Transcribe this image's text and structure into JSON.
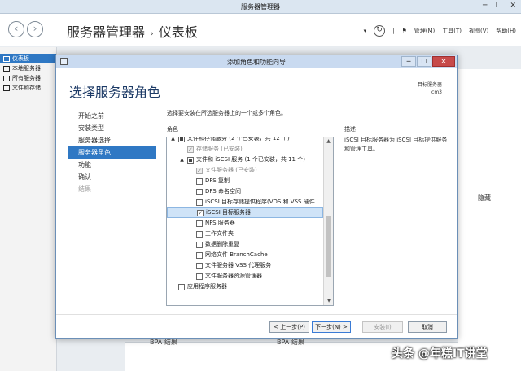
{
  "window": {
    "title": "服务器管理器",
    "controls": [
      "─",
      "☐",
      "✕"
    ]
  },
  "header": {
    "breadcrumb_root": "服务器管理器",
    "breadcrumb_sep": "›",
    "breadcrumb_page": "仪表板",
    "menu": [
      "管理(M)",
      "工具(T)",
      "视图(V)",
      "帮助(H)"
    ]
  },
  "sidebar": {
    "items": [
      {
        "label": "仪表板",
        "icon": "dashboard-icon"
      },
      {
        "label": "本地服务器",
        "icon": "server-icon"
      },
      {
        "label": "所有服务器",
        "icon": "servers-icon"
      },
      {
        "label": "文件和存储",
        "icon": "storage-icon"
      }
    ]
  },
  "background": {
    "hide_label": "隐藏",
    "bpa_1": "BPA 结果",
    "bpa_2": "BPA 结果"
  },
  "watermark": "头条 @年糕IT讲堂",
  "dialog": {
    "title": "添加角色和功能向导",
    "heading": "选择服务器角色",
    "target_label": "目标服务器",
    "target_value": "cm3",
    "steps": [
      {
        "label": "开始之前",
        "state": "normal"
      },
      {
        "label": "安装类型",
        "state": "normal"
      },
      {
        "label": "服务器选择",
        "state": "normal"
      },
      {
        "label": "服务器角色",
        "state": "active"
      },
      {
        "label": "功能",
        "state": "normal"
      },
      {
        "label": "确认",
        "state": "normal"
      },
      {
        "label": "结果",
        "state": "disabled"
      }
    ],
    "instruction": "选择要安装在所选服务器上的一个或多个角色。",
    "roles_header": "角色",
    "desc_header": "描述",
    "description": "iSCSI 目标服务器为 iSCSI 目标提供服务和管理工具。",
    "roles": [
      {
        "label": "文件和存储服务 (2 个已安装，共 12 个)",
        "check": "partial",
        "expander": "▲",
        "indent": 0,
        "dim": false
      },
      {
        "label": "存储服务 (已安装)",
        "check": "grey",
        "expander": "",
        "indent": 1,
        "dim": true
      },
      {
        "label": "文件和 iSCSI 服务 (1 个已安装，共 11 个)",
        "check": "partial",
        "expander": "▲",
        "indent": 1,
        "dim": false
      },
      {
        "label": "文件服务器 (已安装)",
        "check": "grey",
        "expander": "",
        "indent": 2,
        "dim": true
      },
      {
        "label": "DFS 复制",
        "check": "empty",
        "expander": "",
        "indent": 2,
        "dim": false
      },
      {
        "label": "DFS 命名空间",
        "check": "empty",
        "expander": "",
        "indent": 2,
        "dim": false
      },
      {
        "label": "iSCSI 目标存储提供程序(VDS 和 VSS 硬件",
        "check": "empty",
        "expander": "",
        "indent": 2,
        "dim": false
      },
      {
        "label": "iSCSI 目标服务器",
        "check": "checked",
        "expander": "",
        "indent": 2,
        "dim": false,
        "selected": true
      },
      {
        "label": "NFS 服务器",
        "check": "empty",
        "expander": "",
        "indent": 2,
        "dim": false
      },
      {
        "label": "工作文件夹",
        "check": "empty",
        "expander": "",
        "indent": 2,
        "dim": false
      },
      {
        "label": "数据删除重复",
        "check": "empty",
        "expander": "",
        "indent": 2,
        "dim": false
      },
      {
        "label": "网络文件 BranchCache",
        "check": "empty",
        "expander": "",
        "indent": 2,
        "dim": false
      },
      {
        "label": "文件服务器 VSS 代理服务",
        "check": "empty",
        "expander": "",
        "indent": 2,
        "dim": false
      },
      {
        "label": "文件服务器资源管理器",
        "check": "empty",
        "expander": "",
        "indent": 2,
        "dim": false
      },
      {
        "label": "应用程序服务器",
        "check": "empty",
        "expander": "",
        "indent": 0,
        "dim": false
      }
    ],
    "buttons": {
      "prev": "< 上一步(P)",
      "next": "下一步(N) >",
      "install": "安装(I)",
      "cancel": "取消"
    }
  }
}
